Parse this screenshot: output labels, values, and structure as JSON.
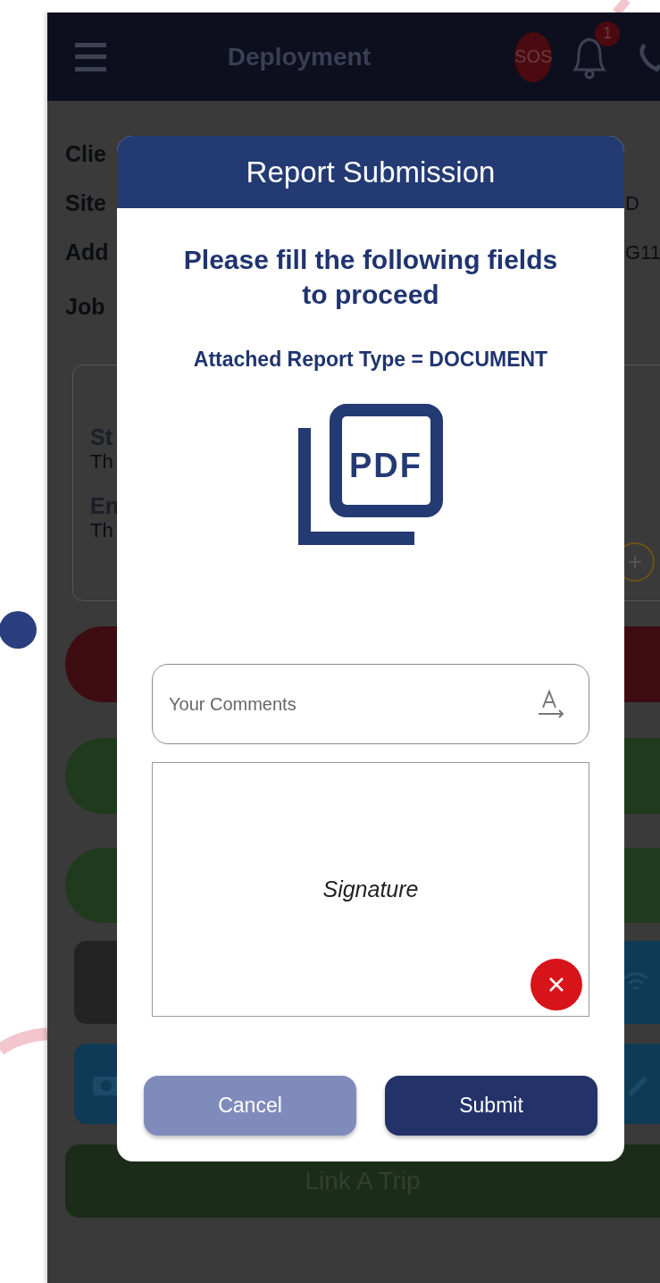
{
  "header": {
    "title": "Deployment",
    "sos": "SOS",
    "notification_count": "1"
  },
  "details": [
    {
      "label": "Clie"
    },
    {
      "label": "Site",
      "value": "D"
    },
    {
      "label": "Add",
      "value": "G11"
    },
    {
      "label": "Job"
    }
  ],
  "card": {
    "lines": [
      {
        "text": "St",
        "kind": "title"
      },
      {
        "text": "Th",
        "kind": "sub"
      },
      {
        "text": "En",
        "kind": "title"
      },
      {
        "text": "Th",
        "kind": "sub"
      }
    ]
  },
  "link_trip": "Link A Trip",
  "dialog": {
    "title": "Report Submission",
    "heading": "Please fill the following fields to proceed",
    "report_type": "Attached Report Type = DOCUMENT",
    "pdf_label": "PDF",
    "comments": {
      "placeholder": "Your Comments"
    },
    "signature": "Signature",
    "buttons": [
      {
        "label": "Cancel",
        "kind": "secondary"
      },
      {
        "label": "Submit",
        "kind": "primary"
      }
    ]
  }
}
